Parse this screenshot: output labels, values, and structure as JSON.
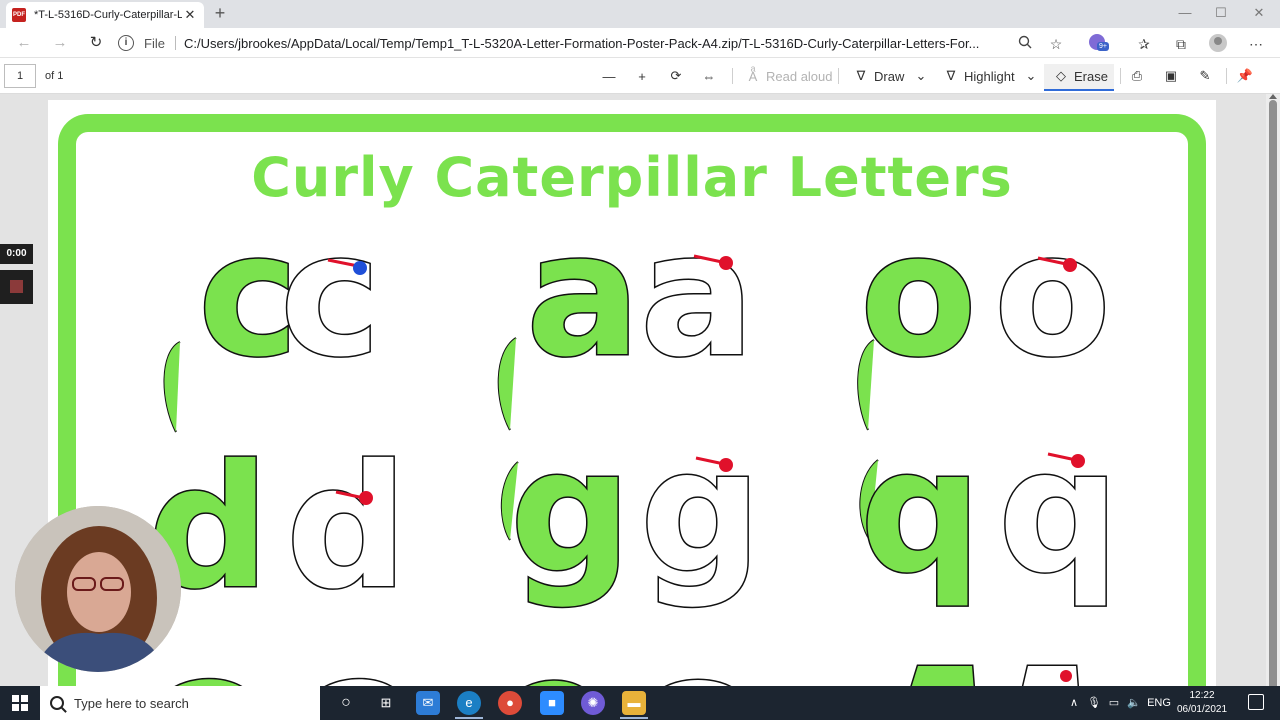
{
  "browser": {
    "tab_title": "*T-L-5316D-Curly-Caterpillar-Let",
    "tab_icon": "pdf-icon",
    "new_tab": "+",
    "close_tab": "✕",
    "window_controls": {
      "minimize": "—",
      "maximize": "☐",
      "close": "✕"
    },
    "address": {
      "scheme_label": "File",
      "url": "C:/Users/jbrookes/AppData/Local/Temp/Temp1_T-L-5320A-Letter-Formation-Poster-Pack-A4.zip/T-L-5316D-Curly-Caterpillar-Letters-For..."
    },
    "extension_badge": "9+"
  },
  "pdf_toolbar": {
    "page_number": "1",
    "page_of": "of 1",
    "read_aloud": "Read aloud",
    "draw": "Draw",
    "highlight": "Highlight",
    "erase": "Erase"
  },
  "document": {
    "title": "Curly Caterpillar Letters",
    "rows": [
      [
        "c",
        "a",
        "o"
      ],
      [
        "d",
        "g",
        "q"
      ]
    ],
    "colors": {
      "green": "#7be24e",
      "red_dot": "#e0112b",
      "blue_dot": "#1f4fd8",
      "outline": "#111111"
    }
  },
  "recording": {
    "timer": "0:00"
  },
  "taskbar": {
    "search_placeholder": "Type here to search",
    "language": "ENG",
    "time": "12:22",
    "date": "06/01/2021",
    "tray_chevron": "∧"
  }
}
